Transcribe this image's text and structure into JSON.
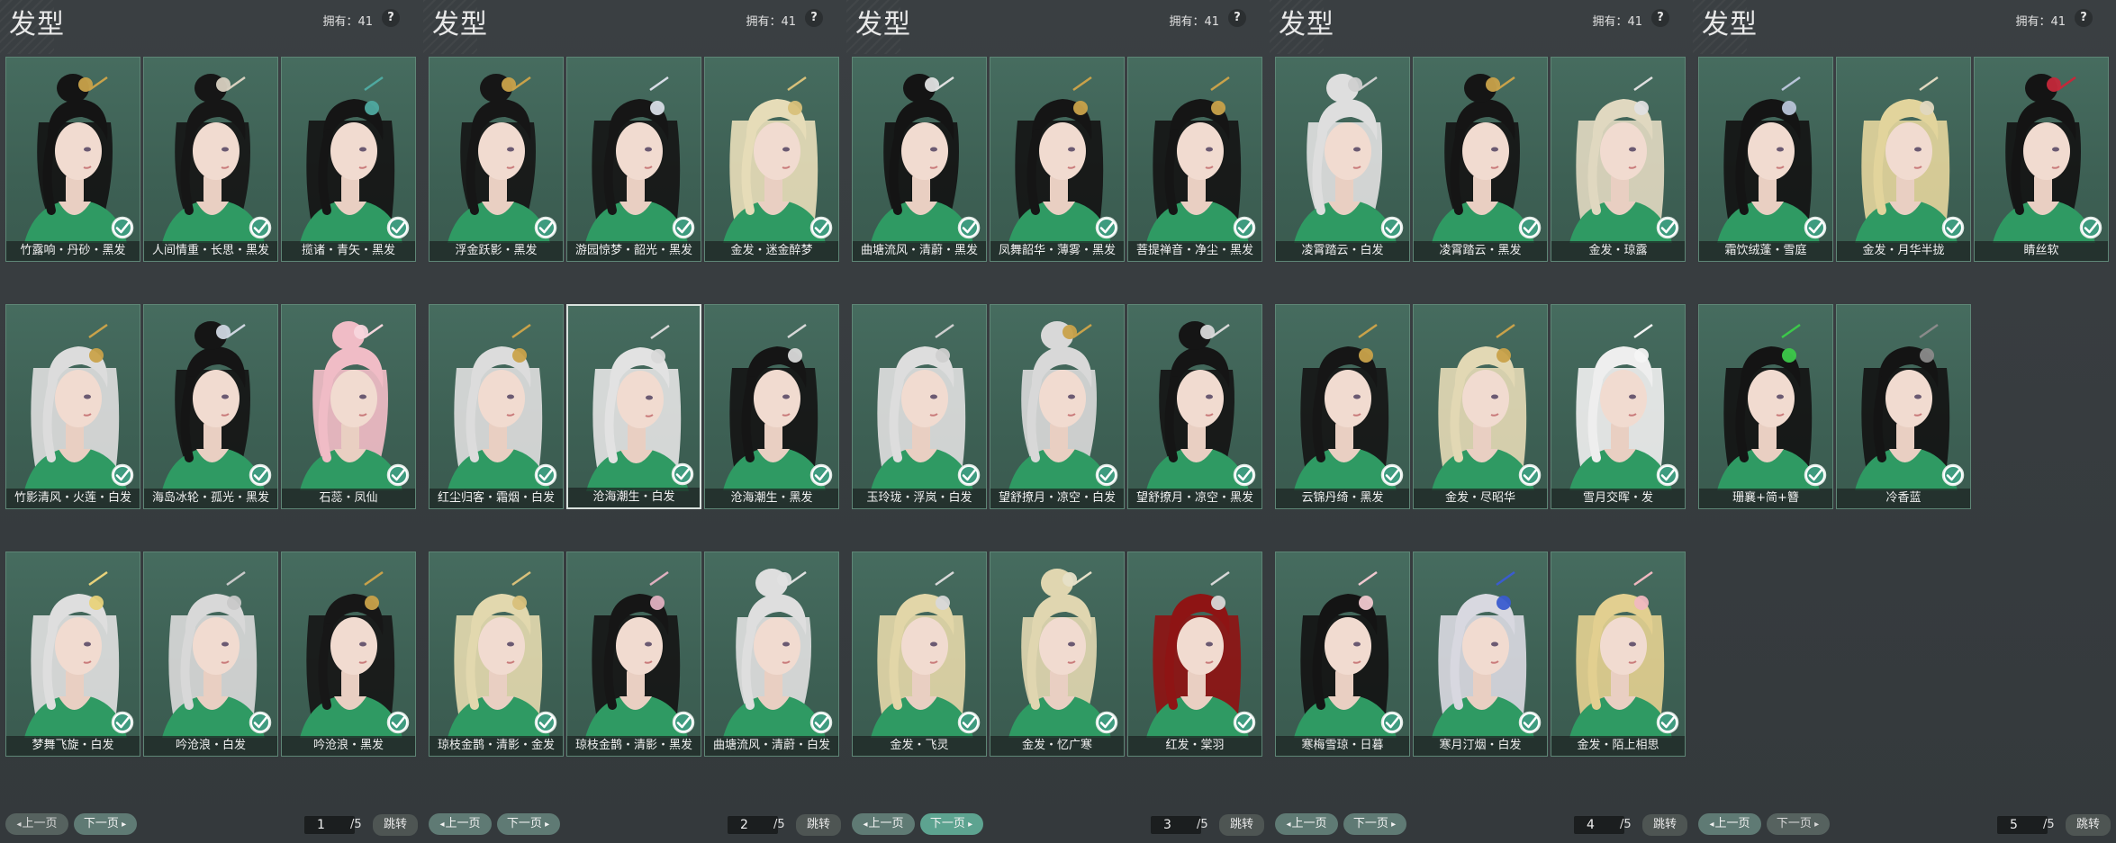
{
  "panels": [
    {
      "title": "发型",
      "owned": "拥有：41",
      "help": "?",
      "cards": [
        {
          "label": "竹露响・丹砂・黑发",
          "hair": "#141414",
          "acc": "#c9a24a",
          "style": "bun"
        },
        {
          "label": "人间情重・长思・黑发",
          "hair": "#161616",
          "acc": "#d8d0c0",
          "style": "bun"
        },
        {
          "label": "揽诸・青矢・黑发",
          "hair": "#151515",
          "acc": "#4fa9a0",
          "style": "long"
        },
        {
          "label": "竹影清风・火莲・白发",
          "hair": "#dcdcdc",
          "acc": "#c9a24a",
          "style": "long"
        },
        {
          "label": "海岛冰轮・孤光・黑发",
          "hair": "#151515",
          "acc": "#cfd6e0",
          "style": "bun"
        },
        {
          "label": "石蕊・凤仙",
          "hair": "#f0bcc6",
          "acc": "#f7d6dd",
          "style": "bun"
        },
        {
          "label": "梦舞飞旋・白发",
          "hair": "#dedede",
          "acc": "#e8d27a",
          "style": "long"
        },
        {
          "label": "吟沧浪・白发",
          "hair": "#d8d8d8",
          "acc": "#c9c9c9",
          "style": "long"
        },
        {
          "label": "吟沧浪・黑发",
          "hair": "#171717",
          "acc": "#c9a24a",
          "style": "long"
        }
      ],
      "pager": {
        "prev": "上一页",
        "next": "下一页",
        "page": "1",
        "total": "/5",
        "jump": "跳转",
        "prev_state": "disabled",
        "next_state": "normal"
      }
    },
    {
      "title": "发型",
      "owned": "拥有：41",
      "help": "?",
      "cards": [
        {
          "label": "浮金跃影・黑发",
          "hair": "#161616",
          "acc": "#c9a24a",
          "style": "bun"
        },
        {
          "label": "游园惊梦・韶光・黑发",
          "hair": "#161616",
          "acc": "#d8dde6",
          "style": "long"
        },
        {
          "label": "金发・迷金醉梦",
          "hair": "#e6dcb8",
          "acc": "#d8c07a",
          "style": "long"
        },
        {
          "label": "红尘归客・霜烟・白发",
          "hair": "#dcdcdc",
          "acc": "#c9a24a",
          "style": "long"
        },
        {
          "label": "沧海潮生・白发",
          "hair": "#e2e2e2",
          "acc": "#d8d8d8",
          "style": "long",
          "selected": true
        },
        {
          "label": "沧海潮生・黑发",
          "hair": "#151515",
          "acc": "#d8d8d8",
          "style": "long"
        },
        {
          "label": "琼枝金鹊・清影・金发",
          "hair": "#e2d8ae",
          "acc": "#d8c07a",
          "style": "long"
        },
        {
          "label": "琼枝金鹊・清影・黑发",
          "hair": "#161616",
          "acc": "#e0b0c0",
          "style": "long"
        },
        {
          "label": "曲塘流风・清蔚・白发",
          "hair": "#dedede",
          "acc": "#e0e0e0",
          "style": "bun"
        }
      ],
      "pager": {
        "prev": "上一页",
        "next": "下一页",
        "page": "2",
        "total": "/5",
        "jump": "跳转",
        "prev_state": "normal",
        "next_state": "normal"
      }
    },
    {
      "title": "发型",
      "owned": "拥有：41",
      "help": "?",
      "cards": [
        {
          "label": "曲塘流风・清蔚・黑发",
          "hair": "#141414",
          "acc": "#e0e0e0",
          "style": "bun"
        },
        {
          "label": "凤舞韶华・薄雾・黑发",
          "hair": "#151515",
          "acc": "#c9a24a",
          "style": "long"
        },
        {
          "label": "菩提禅音・净尘・黑发",
          "hair": "#151515",
          "acc": "#c9a24a",
          "style": "long"
        },
        {
          "label": "玉玲珑・浮岚・白发",
          "hair": "#dddddd",
          "acc": "#cfcfcf",
          "style": "long"
        },
        {
          "label": "望舒撩月・凉空・白发",
          "hair": "#d8d8d8",
          "acc": "#c9a24a",
          "style": "bun"
        },
        {
          "label": "望舒撩月・凉空・黑发",
          "hair": "#151515",
          "acc": "#d8d8d8",
          "style": "bun"
        },
        {
          "label": "金发・飞灵",
          "hair": "#e2d6a8",
          "acc": "#d8d8d8",
          "style": "long"
        },
        {
          "label": "金发・忆广寒",
          "hair": "#e0d6b0",
          "acc": "#e6e0c8",
          "style": "bun"
        },
        {
          "label": "红发・棠羽",
          "hair": "#8e1414",
          "acc": "#d8d8d8",
          "style": "long"
        }
      ],
      "pager": {
        "prev": "上一页",
        "next": "下一页",
        "page": "3",
        "total": "/5",
        "jump": "跳转",
        "prev_state": "normal",
        "next_state": "active"
      }
    },
    {
      "title": "发型",
      "owned": "拥有：41",
      "help": "?",
      "cards": [
        {
          "label": "凌霄踏云・白发",
          "hair": "#dedede",
          "acc": "#cfcfcf",
          "style": "bun"
        },
        {
          "label": "凌霄踏云・黑发",
          "hair": "#151515",
          "acc": "#c9a24a",
          "style": "bun"
        },
        {
          "label": "金发・琼露",
          "hair": "#e0d8c0",
          "acc": "#e0e0e0",
          "style": "long"
        },
        {
          "label": "云锦丹绮・黑发",
          "hair": "#161616",
          "acc": "#c9a24a",
          "style": "long"
        },
        {
          "label": "金发・尽昭华",
          "hair": "#e2d8b4",
          "acc": "#c9a24a",
          "style": "long"
        },
        {
          "label": "雪月交晖・发",
          "hair": "#eeeeee",
          "acc": "#f4f4f4",
          "style": "long"
        },
        {
          "label": "寒梅雪琼・日暮",
          "hair": "#141414",
          "acc": "#f0c8cf",
          "style": "long"
        },
        {
          "label": "寒月汀烟・白发",
          "hair": "#d8d8e0",
          "acc": "#3a5ccf",
          "style": "long"
        },
        {
          "label": "金发・陌上相思",
          "hair": "#e2cf90",
          "acc": "#f0b8c0",
          "style": "long"
        }
      ],
      "pager": {
        "prev": "上一页",
        "next": "下一页",
        "page": "4",
        "total": "/5",
        "jump": "跳转",
        "prev_state": "normal",
        "next_state": "normal"
      }
    },
    {
      "title": "发型",
      "owned": "拥有：41",
      "help": "?",
      "cards": [
        {
          "label": "霜饮绒蓬・雪庭",
          "hair": "#141414",
          "acc": "#b8c4d8",
          "style": "long"
        },
        {
          "label": "金发・月华半拢",
          "hair": "#e2d49c",
          "acc": "#e0d8c0",
          "style": "long"
        },
        {
          "label": "睛丝软",
          "hair": "#141414",
          "acc": "#c4283a",
          "style": "bun"
        },
        {
          "label": "珊襄+简+簪",
          "hair": "#141414",
          "acc": "#3cc84a",
          "style": "long"
        },
        {
          "label": "冷香蓝",
          "hair": "#141414",
          "acc": "#8a8a8a",
          "style": "long"
        }
      ],
      "pager": {
        "prev": "上一页",
        "next": "下一页",
        "page": "5",
        "total": "/5",
        "jump": "跳转",
        "prev_state": "normal",
        "next_state": "disabled"
      }
    }
  ]
}
